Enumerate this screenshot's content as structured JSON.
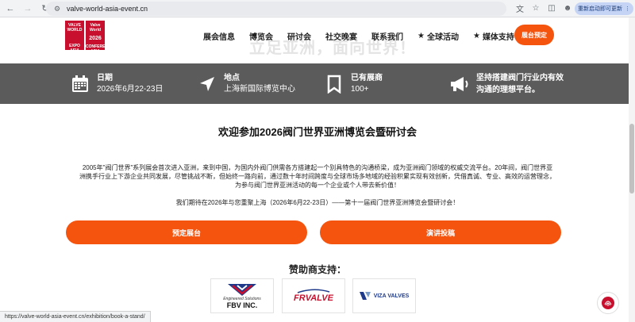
{
  "browser": {
    "url": "valve-world-asia-event.cn",
    "update_label": "重新启动即可更新",
    "update_more": "⋮"
  },
  "logo": {
    "left_top": "VALVE WORLD",
    "left_bottom": "EXPO ASIA",
    "right_top": "Valve World",
    "right_year": "2026",
    "right_bottom": "CONFERENCE ASIA"
  },
  "hero": {
    "watermark": "立足亚洲，面向世界！"
  },
  "nav": {
    "items": [
      {
        "label": "展会信息"
      },
      {
        "label": "博览会"
      },
      {
        "label": "研讨会"
      },
      {
        "label": "社交晚宴"
      },
      {
        "label": "联系我们"
      },
      {
        "label": "全球活动",
        "star": "★"
      },
      {
        "label": "媒体支持",
        "star": "★"
      }
    ],
    "cta": "展台预定"
  },
  "info": {
    "date_label": "日期",
    "date_value": "2026年6月22-23日",
    "location_label": "地点",
    "location_value": "上海新国际博览中心",
    "exhibitors_label": "已有展商",
    "exhibitors_value": "100+",
    "mission_line1": "坚持搭建阀门行业内有效",
    "mission_line2": "沟通的理想平台。"
  },
  "main": {
    "title": "欢迎参加2026阀门世界亚洲博览会暨研讨会",
    "intro_line1": "2005年\"阀门世界\"系列展会首次进入亚洲，来到中国，为国内外阀门供需各方搭建起一个别具特色的沟通桥梁，成为亚洲阀门领域的权威交流平台。20年间，阀门世界亚",
    "intro_line2": "洲携手行业上下游企业共同发展，尽管挑战不断，但始终一路向前，通过数十年时间跨度与全球市场多地域的经验积累实现有效创新，凭借真诚、专业、高效的运营理念，",
    "intro_line3": "为参与阀门世界亚洲活动的每一个企业或个人带去新价值！",
    "expect": "我们期待在2026年与您重聚上海（2026年6月22-23日）——第十一届阀门世界亚洲博览会暨研讨会！",
    "book_button": "预定展台",
    "submit_button": "演讲投稿",
    "sponsors_heading": "赞助商支持："
  },
  "sponsors": [
    {
      "name": "FBV INC.",
      "tagline": "Engineered Solutions"
    },
    {
      "name": "FRVALVE"
    },
    {
      "name": "VIZA VALVES"
    }
  ],
  "status": {
    "hover_url": "https://valve-world-asia-event.cn/exhibition/book-a-stand/"
  },
  "colors": {
    "accent": "#f5540f",
    "brand_red": "#c8102e",
    "info_bar": "#5b5b5b"
  }
}
